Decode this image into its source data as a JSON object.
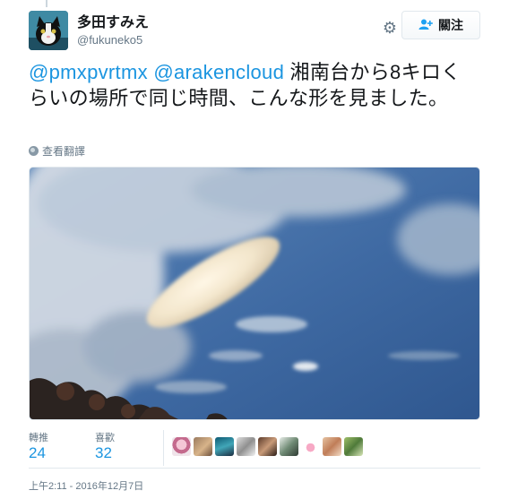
{
  "user": {
    "display_name": "多田すみえ",
    "screen_name": "@fukuneko5"
  },
  "header": {
    "follow_label": "關注",
    "follow_icon": "add-user-icon",
    "settings_icon": "gear-icon"
  },
  "tweet": {
    "mention_1": "@pmxpvrtmx",
    "mention_2": "@arakencloud",
    "text": " 湘南台から8キロくらいの場所で同じ時間、こんな形を見ました。"
  },
  "translate_label": "查看翻譯",
  "stats": {
    "retweets_label": "轉推",
    "retweets_value": "24",
    "likes_label": "喜歡",
    "likes_value": "32",
    "liker_count": 9
  },
  "timestamp": "上午2:11 - 2016年12月7日",
  "colors": {
    "link": "#1b95e0",
    "muted": "#657786",
    "border": "#e1e8ed"
  }
}
